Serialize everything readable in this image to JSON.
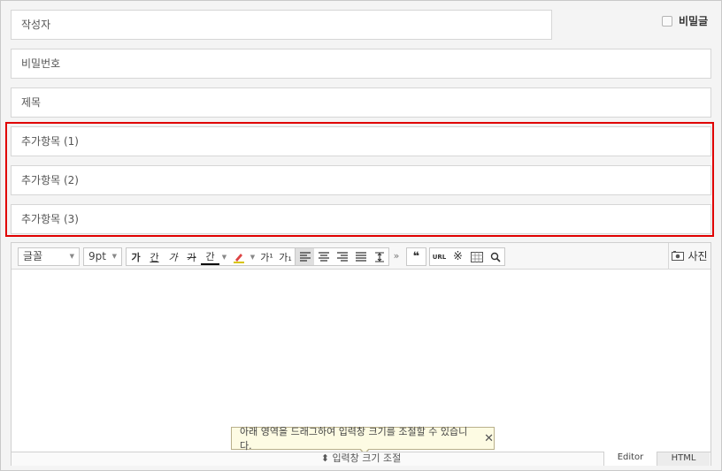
{
  "form": {
    "author_placeholder": "작성자",
    "password_placeholder": "비밀번호",
    "title_placeholder": "제목",
    "secret_label": "비밀글",
    "extra_fields": [
      "추가항목 (1)",
      "추가항목 (2)",
      "추가항목 (3)"
    ]
  },
  "editor": {
    "font_select": "글꼴",
    "size_select": "9pt",
    "format_buttons": [
      "가",
      "간",
      "가",
      "가",
      "간"
    ],
    "superscript": "가¹",
    "subscript": "가₁",
    "more": "»",
    "quote": "❝",
    "url_label": "URL",
    "photo_label": "사진",
    "tooltip_text": "아래 영역을 드래그하여 입력창 크기를 조절할 수 있습니다.",
    "tooltip_close": "✕",
    "resize_label": "입력창 크기 조절",
    "resize_icon": "⬍",
    "mode_editor": "Editor",
    "mode_html": "HTML"
  }
}
